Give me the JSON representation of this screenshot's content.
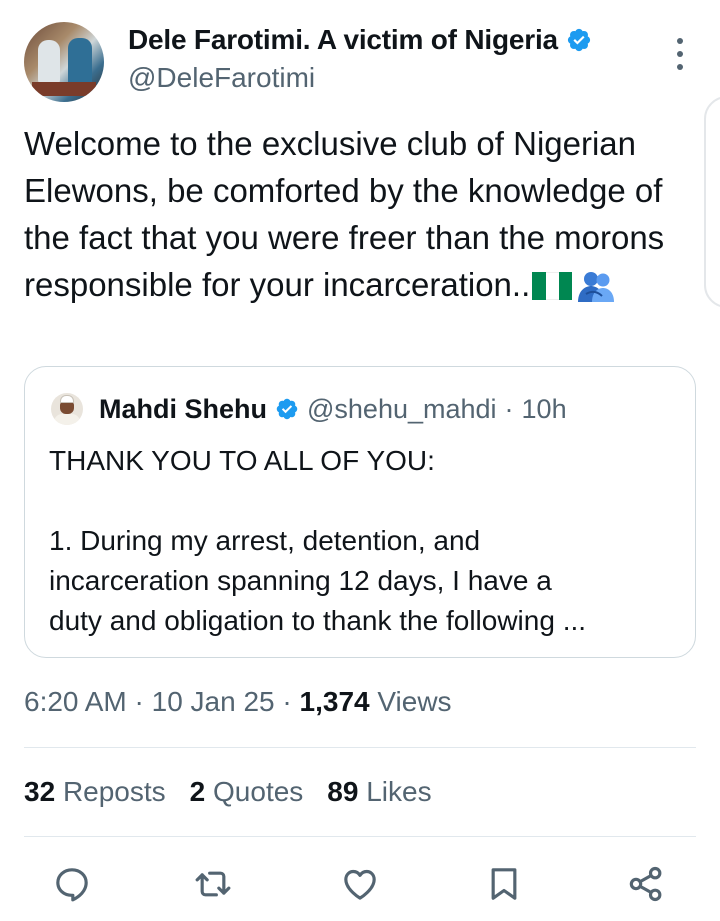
{
  "tweet": {
    "author": {
      "display_name": "Dele Farotimi. A victim of Nigeria",
      "handle": "@DeleFarotimi",
      "verified": true
    },
    "text": "Welcome to the exclusive club of Nigerian Elewons, be comforted by the knowledge of the fact that you were freer than the morons responsible for your incarceration..",
    "emojis": [
      "nigeria-flag",
      "people-hugging"
    ],
    "quoted": {
      "author_name": "Mahdi Shehu",
      "handle": "@shehu_mahdi",
      "separator": "·",
      "age": "10h",
      "line1": "THANK YOU TO ALL OF YOU:",
      "line2": "1. During my arrest, detention, and",
      "line3": "incarceration spanning 12 days, I  have a",
      "line4": "duty and obligation to thank the following ..."
    },
    "meta": {
      "time": "6:20 AM",
      "sep1": "·",
      "date": "10 Jan 25",
      "sep2": "·",
      "views_count": "1,374",
      "views_label": "Views"
    },
    "stats": {
      "reposts_count": "32",
      "reposts_label": "Reposts",
      "quotes_count": "2",
      "quotes_label": "Quotes",
      "likes_count": "89",
      "likes_label": "Likes"
    }
  },
  "colors": {
    "text": "#0f1419",
    "secondary": "#536471",
    "verified_blue": "#1d9bf0",
    "border": "#cfd9de",
    "flag_green": "#008751"
  },
  "icons": [
    "more-vertical-icon",
    "verified-badge-icon",
    "reply-icon",
    "repost-icon",
    "like-icon",
    "bookmark-icon",
    "share-icon"
  ]
}
